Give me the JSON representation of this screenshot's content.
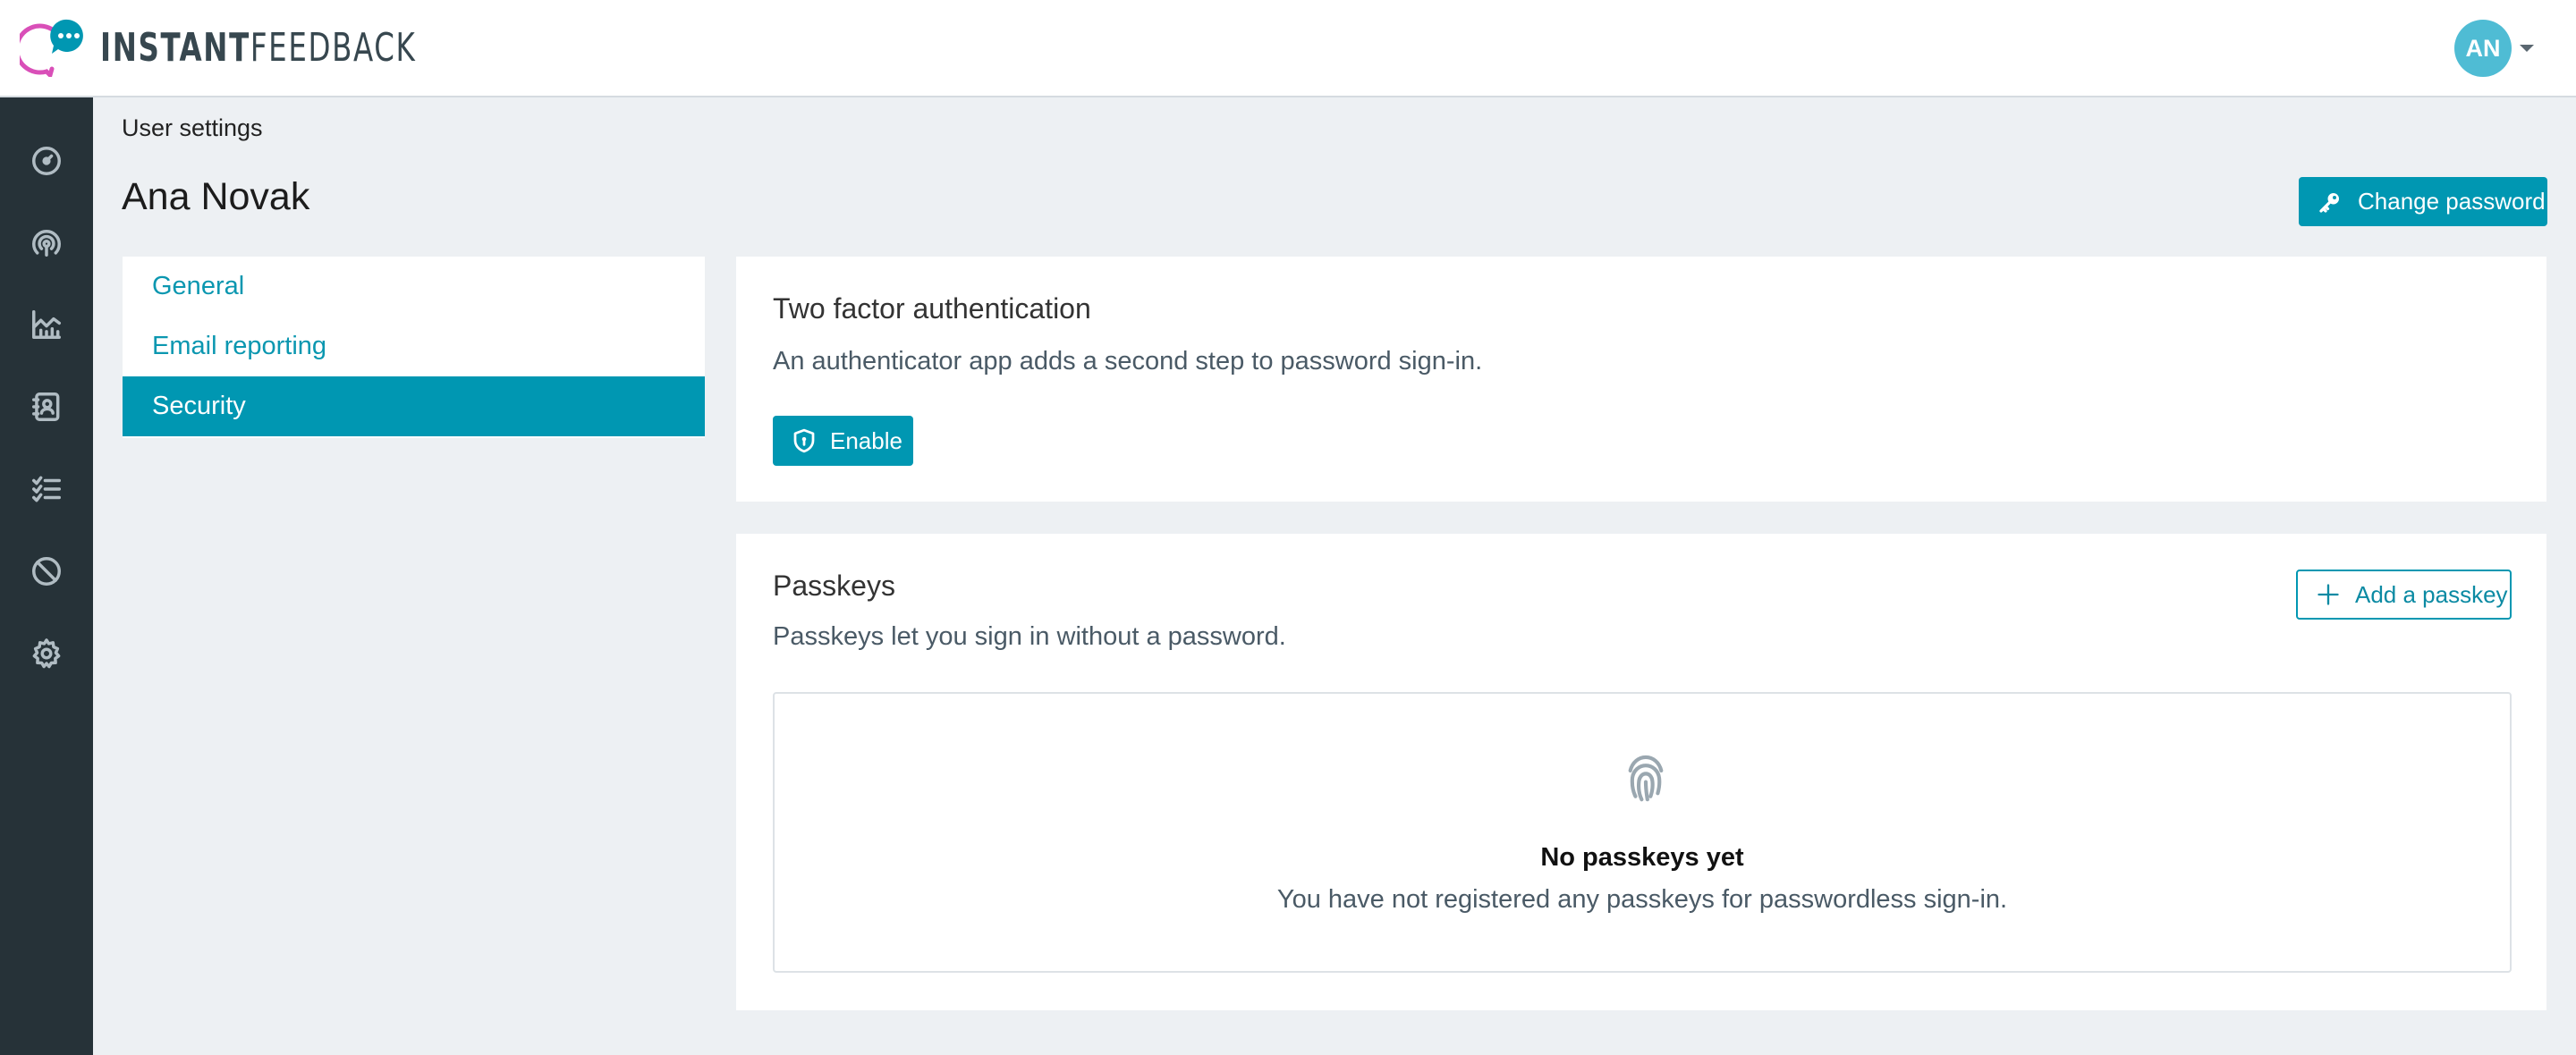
{
  "app": {
    "logo_text_bold": "INSTANT",
    "logo_text_light": "FEEDBACK",
    "brand_color": "#0097b2",
    "logo_accent": "#d94fb8"
  },
  "header": {
    "avatar_initials": "AN",
    "avatar_color": "#4fbcd4"
  },
  "sidebar": {
    "items": [
      {
        "icon": "dashboard-icon"
      },
      {
        "icon": "broadcast-icon"
      },
      {
        "icon": "analytics-chart-icon"
      },
      {
        "icon": "contacts-book-icon"
      },
      {
        "icon": "checklist-icon"
      },
      {
        "icon": "blocked-icon"
      },
      {
        "icon": "settings-gear-icon"
      }
    ]
  },
  "page": {
    "breadcrumb": "User settings",
    "title": "Ana Novak",
    "change_password_label": "Change password"
  },
  "settings_menu": {
    "items": [
      {
        "label": "General",
        "active": false
      },
      {
        "label": "Email reporting",
        "active": false
      },
      {
        "label": "Security",
        "active": true
      }
    ]
  },
  "two_factor": {
    "title": "Two factor authentication",
    "description": "An authenticator app adds a second step to password sign-in.",
    "enable_label": "Enable"
  },
  "passkeys": {
    "title": "Passkeys",
    "description": "Passkeys let you sign in without a password.",
    "add_label": "Add a passkey",
    "empty_title": "No passkeys yet",
    "empty_description": "You have not registered any passkeys for passwordless sign-in."
  }
}
